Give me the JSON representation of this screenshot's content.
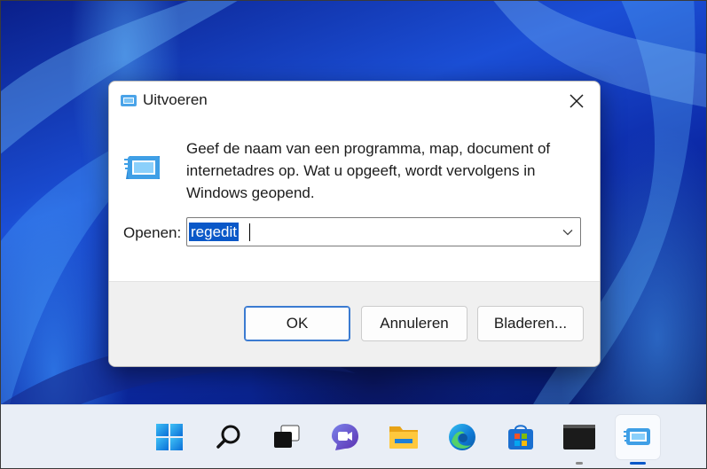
{
  "dialog": {
    "title": "Uitvoeren",
    "message": "Geef de naam van een programma, map, document of internetadres op. Wat u opgeeft, wordt vervolgens in Windows geopend.",
    "open_label": "Openen:",
    "open_value": "regedit",
    "buttons": {
      "ok": "OK",
      "cancel": "Annuleren",
      "browse": "Bladeren..."
    }
  },
  "taskbar": {
    "items": [
      {
        "name": "start",
        "icon": "windows-logo-icon"
      },
      {
        "name": "search",
        "icon": "search-icon"
      },
      {
        "name": "task-view",
        "icon": "task-view-icon"
      },
      {
        "name": "chat",
        "icon": "chat-icon"
      },
      {
        "name": "file-explorer",
        "icon": "folder-icon"
      },
      {
        "name": "edge",
        "icon": "edge-icon"
      },
      {
        "name": "store",
        "icon": "store-icon"
      },
      {
        "name": "terminal",
        "icon": "terminal-icon"
      },
      {
        "name": "run",
        "icon": "run-icon",
        "active": true
      }
    ]
  },
  "colors": {
    "accent": "#0a58c8",
    "taskbar": "#e9eef6"
  }
}
